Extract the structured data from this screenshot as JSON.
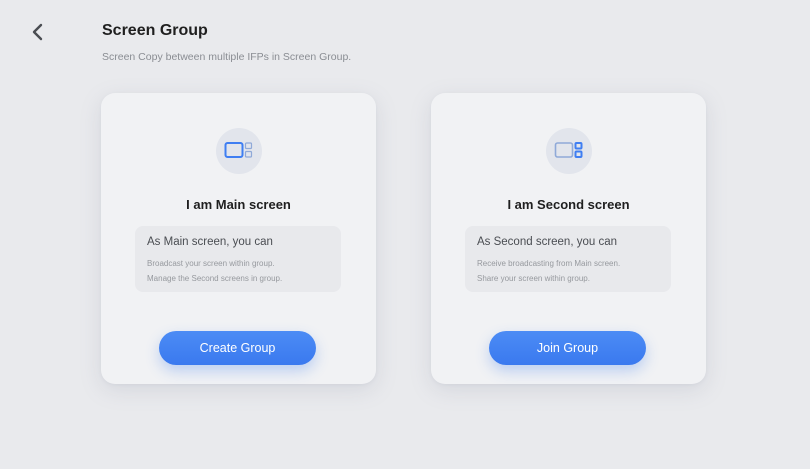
{
  "header": {
    "back_icon": "chevron-left-icon",
    "title": "Screen Group",
    "subtitle": "Screen Copy between multiple IFPs in Screen Group."
  },
  "cards": [
    {
      "icon": "main-screen-icon",
      "title": "I am Main screen",
      "info_heading": "As Main screen, you can",
      "info_lines": [
        "Broadcast your screen within group.",
        "Manage the Second screens in group."
      ],
      "button_label": "Create Group"
    },
    {
      "icon": "second-screen-icon",
      "title": "I am Second screen",
      "info_heading": "As Second screen, you can",
      "info_lines": [
        "Receive broadcasting from Main screen.",
        "Share your screen within group."
      ],
      "button_label": "Join Group"
    }
  ],
  "colors": {
    "background": "#e9eaed",
    "card": "#f1f2f4",
    "accent": "#3a79ef",
    "icon_blue": "#3f7ef2"
  }
}
